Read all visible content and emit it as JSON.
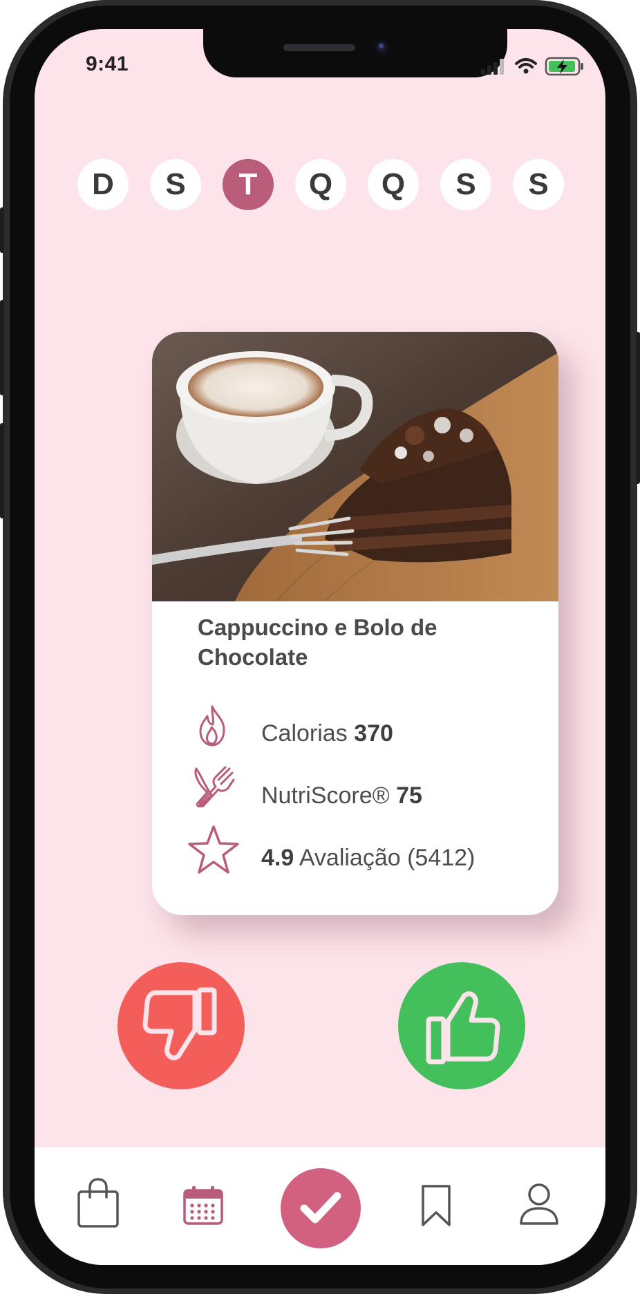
{
  "status_bar": {
    "time": "9:41"
  },
  "days": [
    "D",
    "S",
    "T",
    "Q",
    "Q",
    "S",
    "S"
  ],
  "active_day_index": 2,
  "card": {
    "title": "Cappuccino e Bolo de Chocolate",
    "calories_label": "Calorias",
    "calories_value": "370",
    "nutriscore_label": "NutriScore®",
    "nutriscore_value": "75",
    "rating_value": "4.9",
    "rating_label": "Avaliação (5412)"
  },
  "actions": {
    "dislike_icon": "thumbs-down-icon",
    "like_icon": "thumbs-up-icon"
  },
  "nav": {
    "items": [
      "shopping-bag-icon",
      "calendar-icon",
      "check-icon",
      "bookmark-icon",
      "user-icon"
    ],
    "active_index": 2
  },
  "colors": {
    "background": "#fde3ea",
    "accent": "#b85c79",
    "dislike": "#f35d5a",
    "like": "#43c05c"
  }
}
